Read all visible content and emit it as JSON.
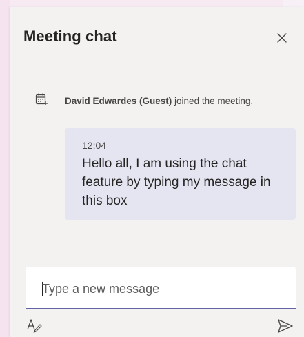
{
  "colors": {
    "panel_bg": "#f3f2f1",
    "bubble_bg": "#e5e5f1",
    "accent": "#6264a7",
    "text_primary": "#252423",
    "text_secondary": "#484644"
  },
  "header": {
    "title": "Meeting chat",
    "close_icon": "close-icon"
  },
  "event": {
    "icon": "calendar-icon",
    "who": "David Edwardes (Guest)",
    "action": " joined the meeting."
  },
  "message": {
    "time": "12:04",
    "text": "Hello all, I am using the chat feature by typing my message in this box"
  },
  "compose": {
    "placeholder": "Type a new message",
    "value": ""
  },
  "toolbar": {
    "format_icon": "format-icon",
    "send_icon": "send-icon"
  }
}
